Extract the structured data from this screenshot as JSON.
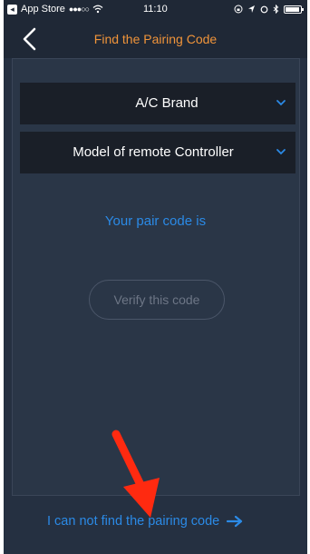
{
  "status_bar": {
    "back_app": "App Store",
    "signal": "●●●○○",
    "time": "11:10"
  },
  "nav": {
    "title": "Find the Pairing Code"
  },
  "dropdowns": [
    {
      "label": "A/C Brand"
    },
    {
      "label": "Model of remote Controller"
    }
  ],
  "pair_code_text": "Your pair code is",
  "verify_button": "Verify this code",
  "cant_find_link": "I can not find the pairing code",
  "colors": {
    "background": "#253041",
    "nav_bar": "#1f2836",
    "title_orange": "#f0943a",
    "link_blue": "#2b8ae6",
    "annotation_red": "#ff2a10"
  },
  "icons": {
    "back": "chevron-left-icon",
    "dropdown": "chevron-down-icon",
    "link_arrow": "arrow-right-icon"
  }
}
